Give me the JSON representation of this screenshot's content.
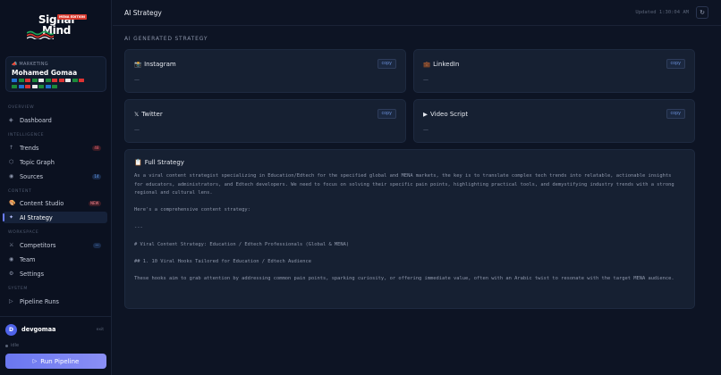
{
  "logo": {
    "line1": "Signal",
    "line2": "Mind",
    "badge": "MENA EDITION"
  },
  "profile": {
    "tag": "MARKETING",
    "name": "Mohamed Gomaa",
    "flag_colors": [
      "#1f6fd1",
      "#1c8a3a",
      "#d33",
      "#1c8a3a",
      "#e8e8e8",
      "#1c8a3a",
      "#d33",
      "#d33",
      "#e8e8e8",
      "#1c8a3a",
      "#d33",
      "#1c8a3a",
      "#1f6fd1",
      "#d33",
      "#e8e8e8",
      "#1c8a3a",
      "#1f6fd1",
      "#1c8a3a"
    ]
  },
  "nav": {
    "sections": {
      "overview": "OVERVIEW",
      "intelligence": "INTELLIGENCE",
      "content": "CONTENT",
      "workspace": "WORKSPACE",
      "system": "SYSTEM"
    },
    "items": {
      "dashboard": {
        "label": "Dashboard",
        "icon": "◈"
      },
      "trends": {
        "label": "Trends",
        "icon": "↑",
        "badge": "48"
      },
      "topic_graph": {
        "label": "Topic Graph",
        "icon": "⬡"
      },
      "sources": {
        "label": "Sources",
        "icon": "◉",
        "badge": "14"
      },
      "content_studio": {
        "label": "Content Studio",
        "icon": "🎨",
        "badge": "NEW"
      },
      "ai_strategy": {
        "label": "AI Strategy",
        "icon": "✦"
      },
      "competitors": {
        "label": "Competitors",
        "icon": "⚔",
        "badge": "—"
      },
      "team": {
        "label": "Team",
        "icon": "◉"
      },
      "settings": {
        "label": "Settings",
        "icon": "⚙"
      },
      "pipeline_runs": {
        "label": "Pipeline Runs",
        "icon": "▷"
      }
    }
  },
  "user": {
    "initial": "D",
    "name": "devgomaa",
    "exit": "exit"
  },
  "status": {
    "text": "idle"
  },
  "run_button": {
    "label": "Run Pipeline"
  },
  "topbar": {
    "title": "AI Strategy",
    "updated": "Updated 1:30:04 AM",
    "refresh_icon": "↻"
  },
  "main": {
    "heading": "AI GENERATED STRATEGY",
    "copy_label": "copy",
    "cards": {
      "instagram": {
        "title": "Instagram",
        "icon": "📸",
        "body": "—"
      },
      "linkedin": {
        "title": "LinkedIn",
        "icon": "💼",
        "body": "—"
      },
      "twitter": {
        "title": "Twitter",
        "icon": "𝕏",
        "body": "—"
      },
      "video": {
        "title": "Video Script",
        "icon": "▶",
        "body": "—"
      }
    },
    "full": {
      "title": "Full Strategy",
      "icon": "📋",
      "paragraphs": [
        "As a viral content strategist specializing in Education/Edtech for the specified global and MENA markets, the key is to translate complex tech trends into relatable, actionable insights for educators, administrators, and Edtech developers. We need to focus on solving their specific pain points, highlighting practical tools, and demystifying industry trends with a strong regional and cultural lens.",
        "Here's a comprehensive content strategy:",
        "---",
        "# Viral Content Strategy: Education / Edtech Professionals (Global & MENA)",
        "## 1. 10 Viral Hooks Tailored for Education / Edtech Audience",
        "These hooks aim to grab attention by addressing common pain points, sparking curiosity, or offering immediate value, often with an Arabic twist to resonate with the target MENA audience."
      ]
    }
  }
}
